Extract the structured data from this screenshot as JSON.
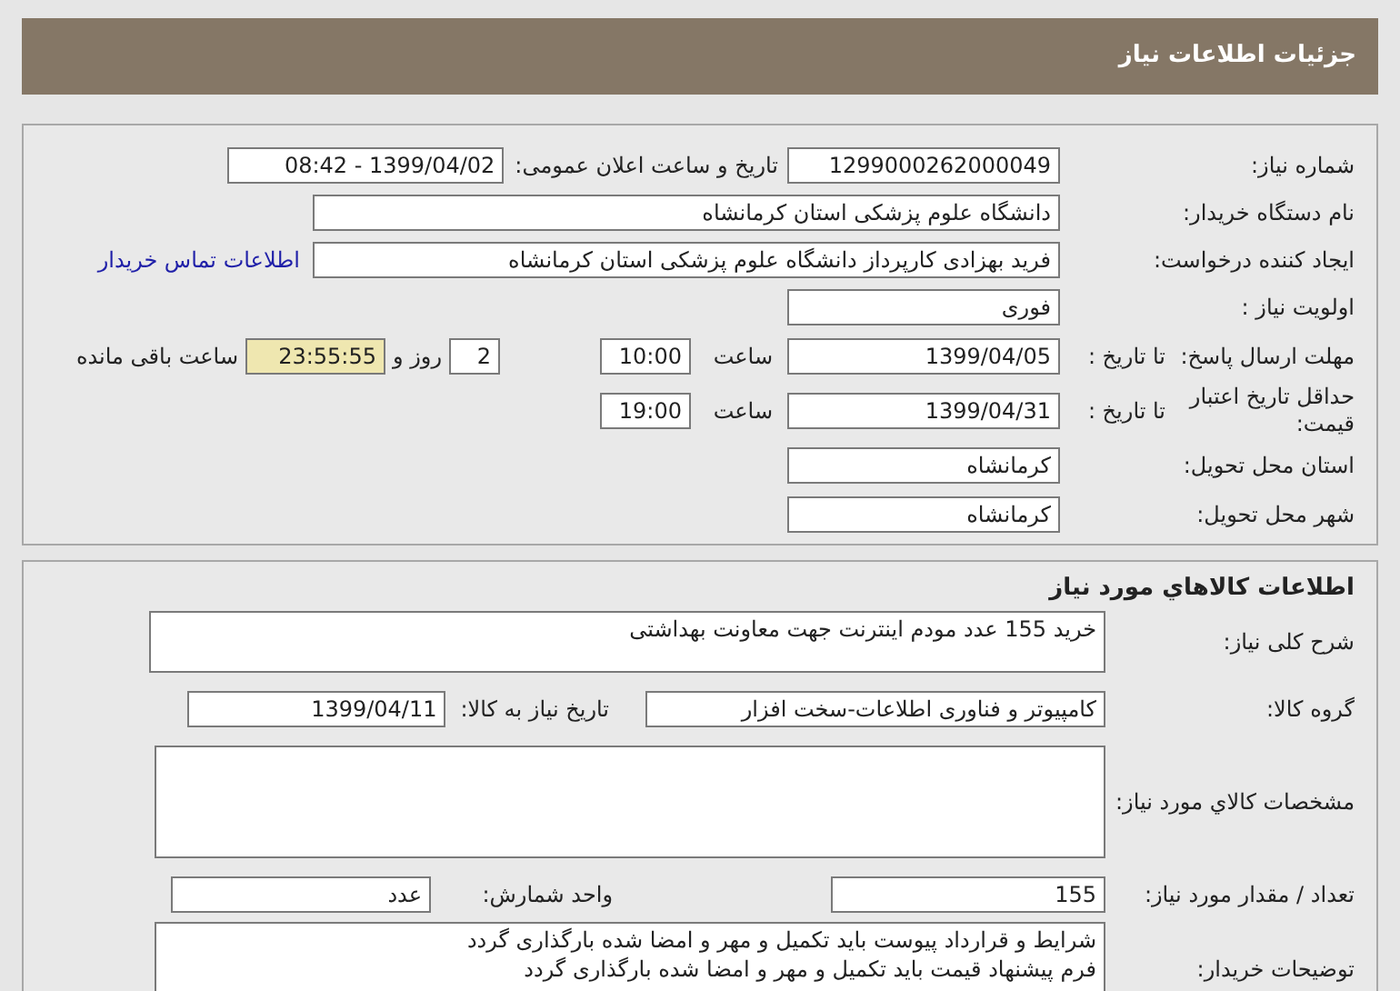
{
  "header": {
    "title": "جزئیات اطلاعات نیاز"
  },
  "details": {
    "need_number": {
      "label": "شماره نیاز:",
      "value": "1299000262000049"
    },
    "announce": {
      "label": "تاریخ و ساعت اعلان عمومی:",
      "value": "1399/04/02 - 08:42"
    },
    "buyer_org": {
      "label": "نام دستگاه خریدار:",
      "value": "دانشگاه علوم پزشکی  استان کرمانشاه"
    },
    "requester": {
      "label": "ایجاد کننده درخواست:",
      "value": "فرید  بهزادی کارپرداز دانشگاه علوم پزشکی  استان کرمانشاه",
      "link": "اطلاعات تماس خریدار"
    },
    "priority": {
      "label": "اولویت نیاز :",
      "value": "فوری"
    },
    "response_deadline": {
      "label": "مهلت ارسال پاسخ:",
      "sublabel": "تا تاریخ :",
      "date": "1399/04/05",
      "time_label": "ساعت",
      "time": "10:00",
      "days": "2",
      "days_label": "روز و",
      "remaining": "23:55:55",
      "remaining_label": "ساعت باقی مانده"
    },
    "price_validity": {
      "label": "حداقل تاریخ اعتبار قیمت:",
      "sublabel": "تا تاریخ :",
      "date": "1399/04/31",
      "time_label": "ساعت",
      "time": "19:00"
    },
    "province": {
      "label": "استان محل تحویل:",
      "value": "کرمانشاه"
    },
    "city": {
      "label": "شهر محل تحویل:",
      "value": "کرمانشاه"
    }
  },
  "goods": {
    "title": "اطلاعات کالاهاي مورد نیاز",
    "description": {
      "label": "شرح کلی نیاز:",
      "value": "خرید 155 عدد مودم اینترنت جهت معاونت بهداشتی"
    },
    "group": {
      "label": "گروه کالا:",
      "value": "کامپیوتر و فناوری اطلاعات-سخت افزار",
      "need_date_label": "تاریخ نیاز به کالا:",
      "need_date": "1399/04/11"
    },
    "specs": {
      "label": "مشخصات کالاي مورد نیاز:"
    },
    "quantity": {
      "label": "تعداد / مقدار مورد نیاز:",
      "value": "155",
      "unit_label": "واحد شمارش:",
      "unit": "عدد"
    },
    "buyer_notes": {
      "label": "توضیحات خریدار:",
      "lines": [
        "شرایط و قرارداد پیوست باید تکمیل و مهر و امضا شده بارگذاری گردد",
        "فرم پیشنهاد قیمت باید تکمیل و مهر و امضا شده بارگذاری گردد"
      ]
    }
  }
}
